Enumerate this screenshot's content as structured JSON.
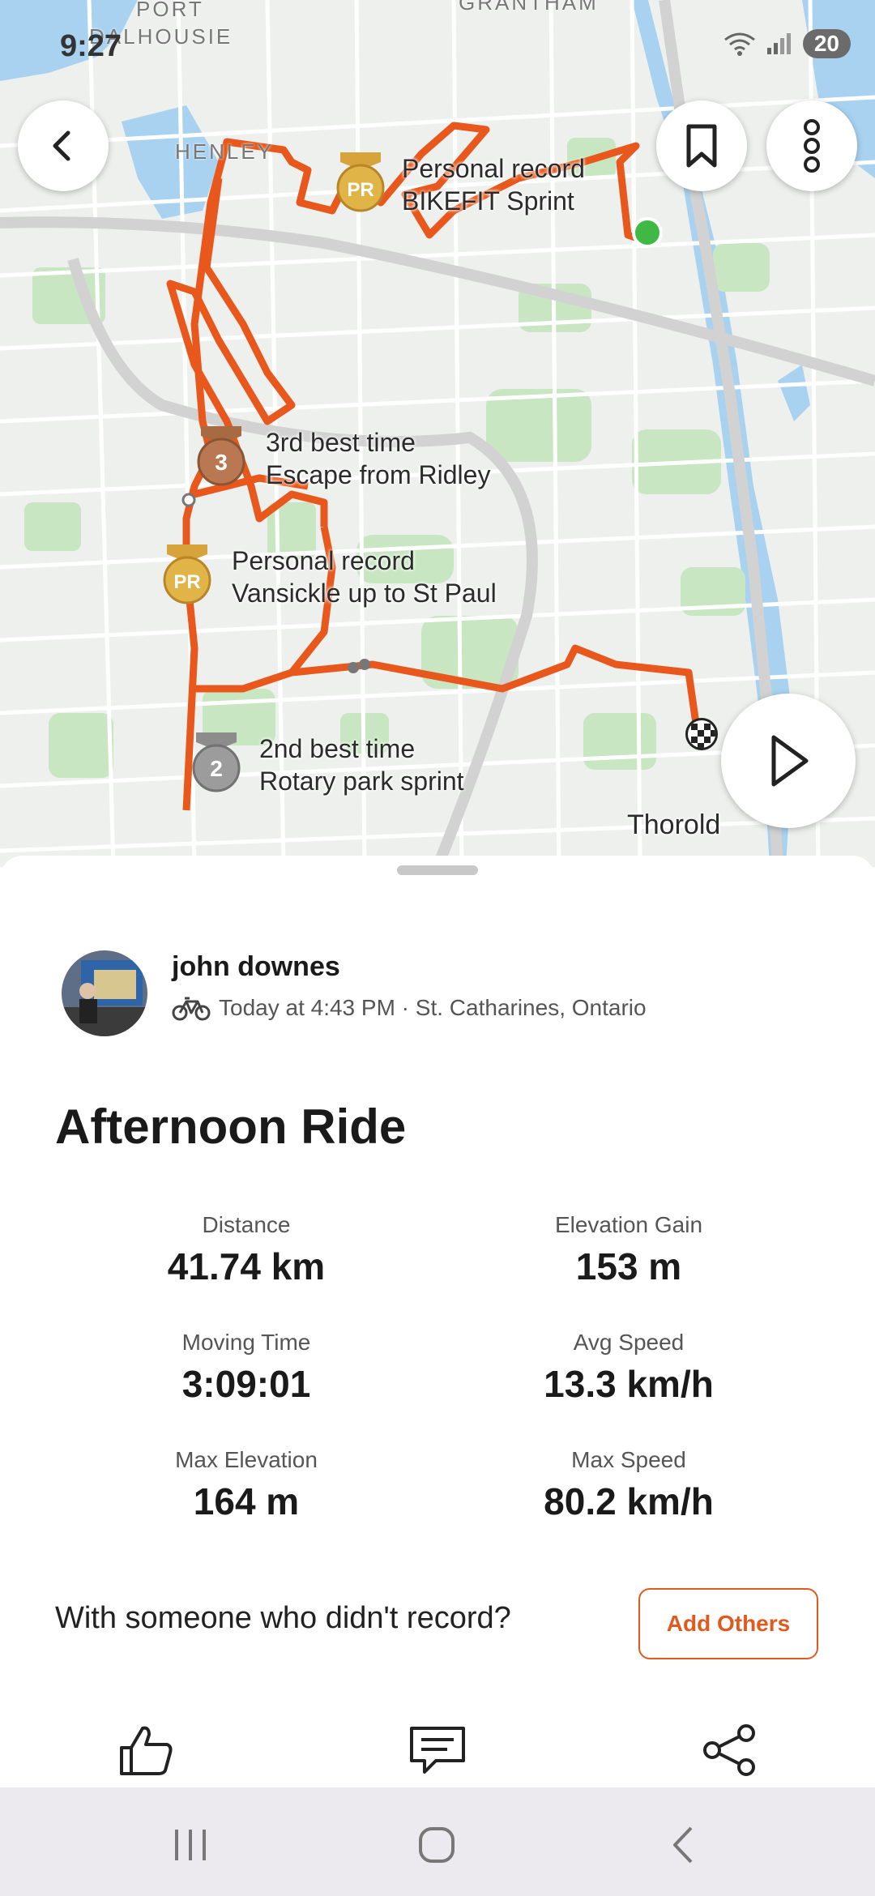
{
  "status_bar": {
    "time": "9:27",
    "battery": "20"
  },
  "map": {
    "place_labels": [
      "PORT",
      "DALHOUSIE",
      "GRANTHAM",
      "HENLEY",
      "Thorold"
    ],
    "segments": [
      {
        "medal": "PR",
        "line1": "Personal record",
        "line2": "BIKEFIT Sprint"
      },
      {
        "medal": "3",
        "line1": "3rd best time",
        "line2": "Escape from Ridley"
      },
      {
        "medal": "PR",
        "line1": "Personal record",
        "line2": "Vansickle up to St Paul"
      },
      {
        "medal": "2",
        "line1": "2nd best time",
        "line2": "Rotary park sprint"
      }
    ],
    "route_color": "#e8581c",
    "start_color": "#3fb844"
  },
  "toolbar": {
    "back_icon": "chevron-left-icon",
    "bookmark_icon": "bookmark-icon",
    "more_icon": "more-vertical-icon",
    "play_icon": "play-icon"
  },
  "activity": {
    "athlete": "john downes",
    "meta": "Today at 4:43 PM · St. Catharines, Ontario",
    "title": "Afternoon Ride",
    "stats": [
      {
        "label": "Distance",
        "value": "41.74 km"
      },
      {
        "label": "Elevation Gain",
        "value": "153 m"
      },
      {
        "label": "Moving Time",
        "value": "3:09:01"
      },
      {
        "label": "Avg Speed",
        "value": "13.3 km/h"
      },
      {
        "label": "Max Elevation",
        "value": "164 m"
      },
      {
        "label": "Max Speed",
        "value": "80.2 km/h"
      }
    ],
    "prompt": "With someone who didn't record?",
    "add_others": "Add Others"
  },
  "colors": {
    "accent": "#e05a1f"
  }
}
